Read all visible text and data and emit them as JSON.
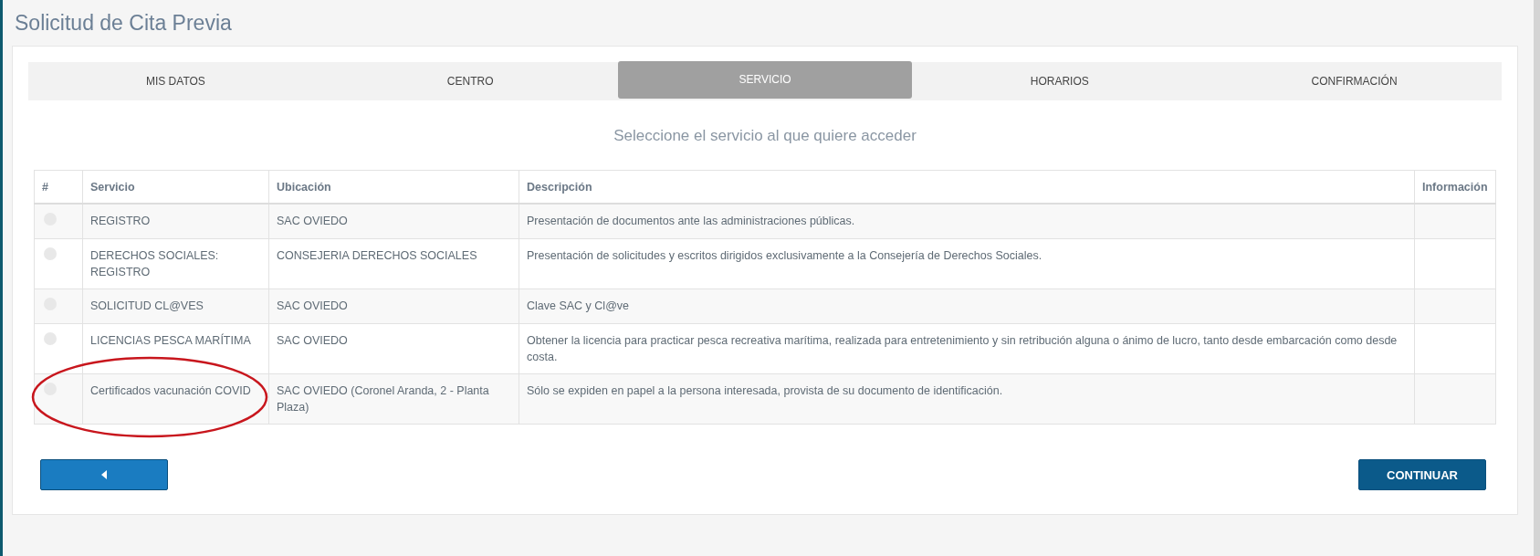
{
  "page_title": "Solicitud de Cita Previa",
  "steps": [
    {
      "label": "MIS DATOS",
      "selected": false
    },
    {
      "label": "CENTRO",
      "selected": false
    },
    {
      "label": "SERVICIO",
      "selected": true
    },
    {
      "label": "HORARIOS",
      "selected": false
    },
    {
      "label": "CONFIRMACIÓN",
      "selected": false
    }
  ],
  "instruction": "Seleccione el servicio al que quiere acceder",
  "table": {
    "columns": [
      "#",
      "Servicio",
      "Ubicación",
      "Descripción",
      "Información"
    ],
    "rows": [
      {
        "selected": false,
        "servicio": "REGISTRO",
        "ubicacion": "SAC OVIEDO",
        "descripcion": "Presentación de documentos ante las administraciones públicas."
      },
      {
        "selected": false,
        "servicio": "DERECHOS SOCIALES: REGISTRO",
        "ubicacion": "CONSEJERIA DERECHOS SOCIALES",
        "descripcion": "Presentación de solicitudes y escritos dirigidos exclusivamente a la Consejería de Derechos Sociales."
      },
      {
        "selected": false,
        "servicio": "SOLICITUD CL@VES",
        "ubicacion": "SAC OVIEDO",
        "descripcion": "Clave SAC y Cl@ve"
      },
      {
        "selected": false,
        "servicio": "LICENCIAS PESCA MARÍTIMA",
        "ubicacion": "SAC OVIEDO",
        "descripcion": "Obtener la licencia para practicar pesca recreativa marítima, realizada para entretenimiento y sin retribución alguna o ánimo de lucro, tanto desde embarcación como desde costa."
      },
      {
        "selected": false,
        "servicio": "Certificados vacunación COVID",
        "ubicacion": "SAC OVIEDO (Coronel Aranda, 2 - Planta Plaza)",
        "descripcion": "Sólo se expiden en papel a la persona interesada, provista de su documento de identificación."
      }
    ]
  },
  "buttons": {
    "back": {
      "kind": "back"
    },
    "continue": {
      "label": "CONTINUAR"
    }
  }
}
